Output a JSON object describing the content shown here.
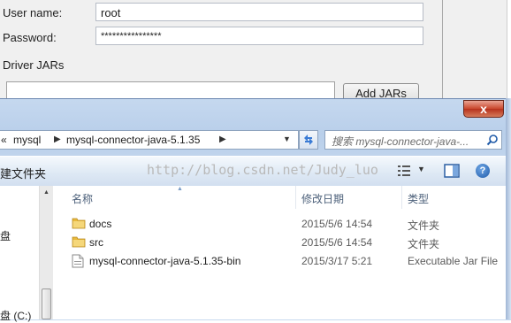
{
  "connection_form": {
    "username_label": "User name:",
    "username_value": "root",
    "password_label": "Password:",
    "password_value": "****************",
    "driver_jars_label": "Driver JARs",
    "add_jars_label": "Add JARs"
  },
  "file_dialog": {
    "close_label": "x",
    "breadcrumb": [
      "«",
      "mysql",
      "mysql-connector-java-5.1.35"
    ],
    "search_placeholder": "搜索 mysql-connector-java-...",
    "toolbar": {
      "new_folder_label": "建文件夹",
      "help_label": "?"
    },
    "watermark": "http://blog.csdn.net/Judy_luo",
    "nav_pane": {
      "item_1": "盘",
      "item_2": "盘 (C:)"
    },
    "columns": {
      "name": "名称",
      "modified": "修改日期",
      "type": "类型"
    },
    "files": [
      {
        "name": "docs",
        "modified": "2015/5/6 14:54",
        "type": "文件夹",
        "icon": "folder-icon"
      },
      {
        "name": "src",
        "modified": "2015/5/6 14:54",
        "type": "文件夹",
        "icon": "folder-icon"
      },
      {
        "name": "mysql-connector-java-5.1.35-bin",
        "modified": "2015/3/17 5:21",
        "type": "Executable Jar File",
        "icon": "jar-file-icon"
      }
    ]
  },
  "colors": {
    "aero_glass": "#b9cfea",
    "close_red": "#c9462c",
    "folder_yellow": "#e8b93c",
    "header_text": "#4c607a"
  }
}
